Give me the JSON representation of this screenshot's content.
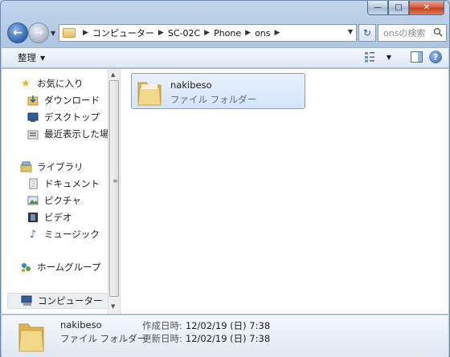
{
  "window": {
    "caption_buttons": {
      "minimize": "—",
      "maximize": "□",
      "close": "✕"
    }
  },
  "nav": {
    "back_glyph": "←",
    "forward_glyph": "→",
    "breadcrumbs": [
      "コンピューター",
      "SC-02C",
      "Phone",
      "ons"
    ],
    "refresh_glyph": "↻",
    "search_placeholder": "onsの検索"
  },
  "toolbar": {
    "organize_label": "整理",
    "views_icon": "views-icon",
    "preview_pane_icon": "preview-pane-icon",
    "help_icon": "help-icon",
    "help_glyph": "?"
  },
  "sidebar": {
    "favorites": {
      "label": "お気に入り",
      "items": [
        {
          "label": "ダウンロード",
          "icon": "downloads-icon"
        },
        {
          "label": "デスクトップ",
          "icon": "desktop-icon"
        },
        {
          "label": "最近表示した場所",
          "icon": "recent-places-icon"
        }
      ]
    },
    "libraries": {
      "label": "ライブラリ",
      "items": [
        {
          "label": "ドキュメント",
          "icon": "documents-icon"
        },
        {
          "label": "ピクチャ",
          "icon": "pictures-icon"
        },
        {
          "label": "ビデオ",
          "icon": "videos-icon"
        },
        {
          "label": "ミュージック",
          "icon": "music-icon"
        }
      ]
    },
    "homegroup": {
      "label": "ホームグループ"
    },
    "computer": {
      "label": "コンピューター"
    }
  },
  "files": [
    {
      "name": "nakibeso",
      "type": "ファイル フォルダー"
    }
  ],
  "details": {
    "name": "nakibeso",
    "type": "ファイル フォルダー",
    "created_label": "作成日時:",
    "created_value": "12/02/19 (日) 7:38",
    "modified_label": "更新日時:",
    "modified_value": "12/02/19 (日) 7:38"
  },
  "colors": {
    "accent": "#2d63b3",
    "selection": "#d3e5fb",
    "folder": "#e4c266"
  }
}
